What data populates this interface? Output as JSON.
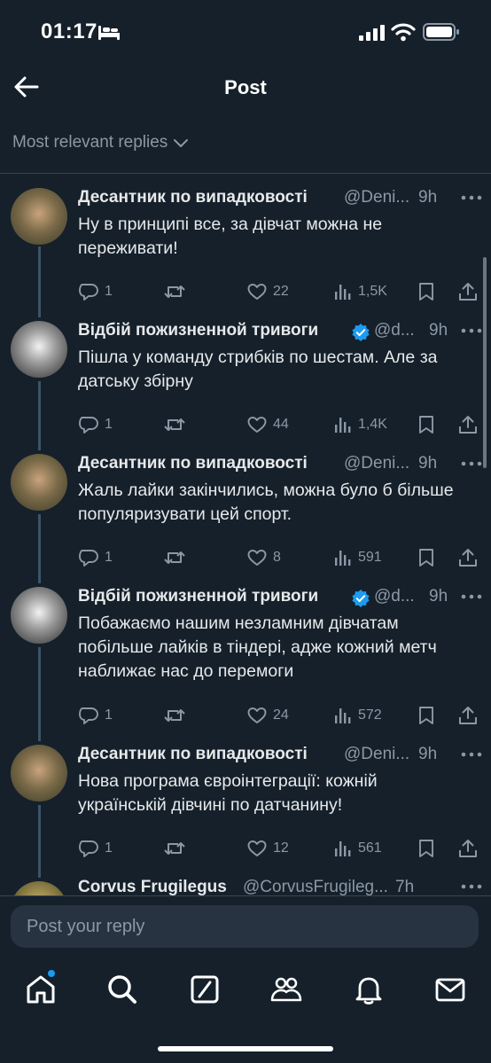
{
  "status_bar": {
    "time": "01:17"
  },
  "header": {
    "title": "Post"
  },
  "sort": {
    "label": "Most relevant replies"
  },
  "tweets": [
    {
      "name": "Десантник по випадковості",
      "handle": "@Deni...",
      "time": "9h",
      "verified": false,
      "text": "Ну в принципі все, за дівчат можна не переживати!",
      "replies": "1",
      "likes": "22",
      "views": "1,5K"
    },
    {
      "name": "Відбій пожизненной тривоги",
      "handle": "@d...",
      "time": "9h",
      "verified": true,
      "text": "Пішла у команду стрибків по шестам. Але за датську збірну",
      "replies": "1",
      "likes": "44",
      "views": "1,4K"
    },
    {
      "name": "Десантник по випадковості",
      "handle": "@Deni...",
      "time": "9h",
      "verified": false,
      "text": "Жаль лайки закінчились, можна було б більше популяризувати цей спорт.",
      "replies": "1",
      "likes": "8",
      "views": "591"
    },
    {
      "name": "Відбій пожизненной тривоги",
      "handle": "@d...",
      "time": "9h",
      "verified": true,
      "text": "Побажаємо нашим незламним дівчатам побільше лайків в тіндері, адже кожний метч наближає нас до перемоги",
      "replies": "1",
      "likes": "24",
      "views": "572"
    },
    {
      "name": "Десантник по випадковості",
      "handle": "@Deni...",
      "time": "9h",
      "verified": false,
      "text": "Нова програма євроінтеграції: кожній українській дівчині по датчанину!",
      "replies": "1",
      "likes": "12",
      "views": "561"
    }
  ],
  "peek_tweet": {
    "name": "Corvus Frugilegus",
    "handle": "@CorvusFrugileg...",
    "time": "7h"
  },
  "reply_bar": {
    "placeholder": "Post your reply"
  },
  "nav": [
    "home-icon",
    "search-icon",
    "grok-icon",
    "communities-icon",
    "notifications-icon",
    "messages-icon"
  ],
  "colors": {
    "background": "#15202b",
    "accent": "#1d9bf0",
    "muted": "#8b98a5",
    "divider": "#38444d"
  }
}
